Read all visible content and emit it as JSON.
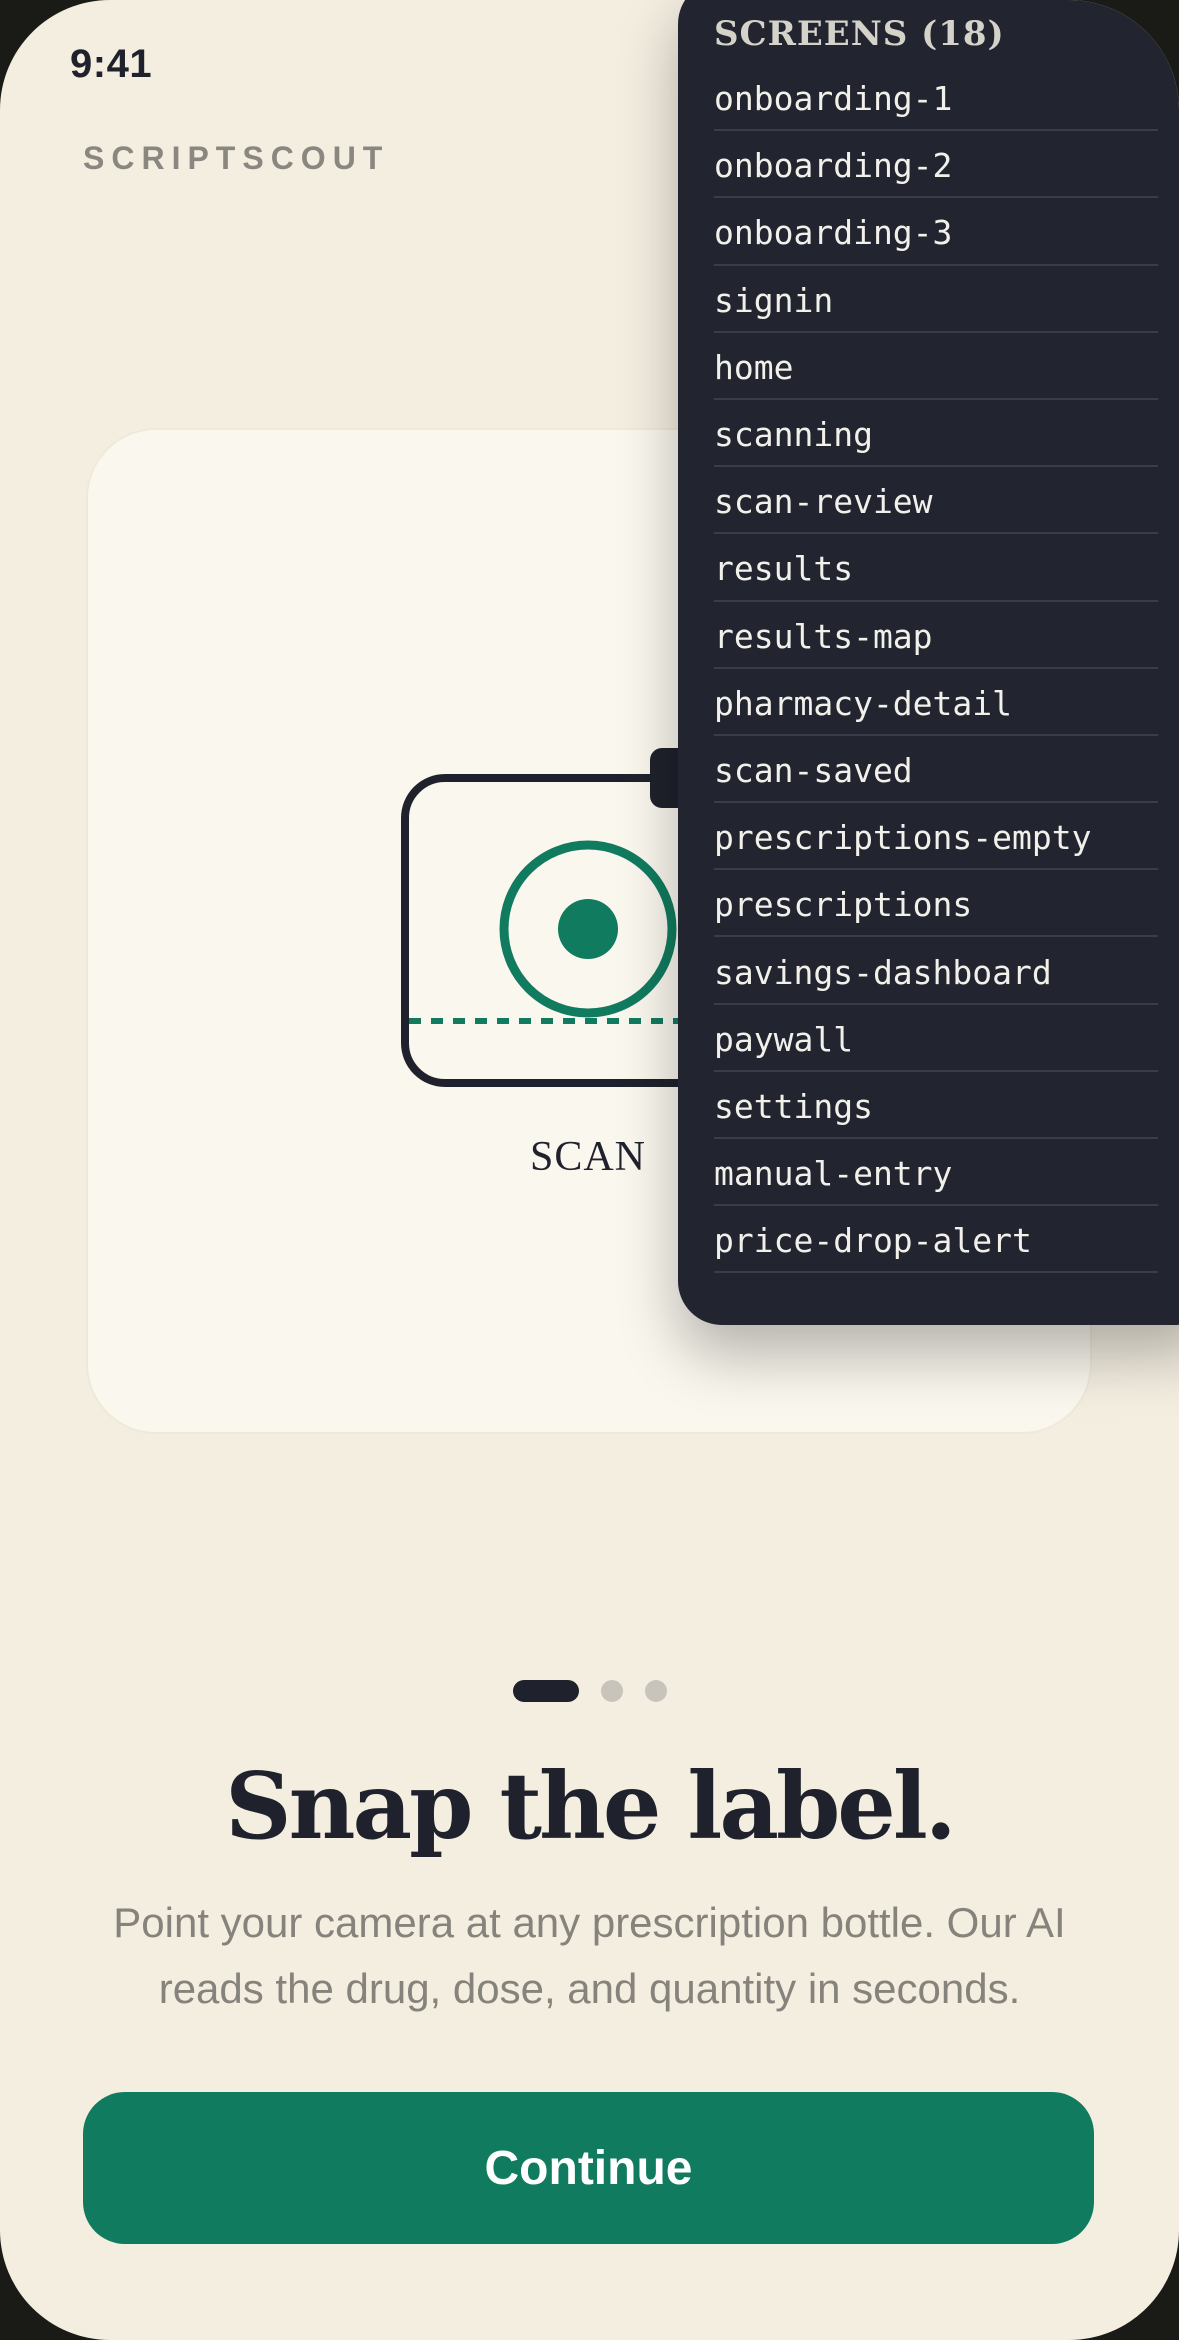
{
  "status_bar": {
    "time": "9:41"
  },
  "brand": "SCRIPTSCOUT",
  "illustration": {
    "label": "SCAN"
  },
  "pager": {
    "count": 3,
    "active": 0
  },
  "headline": "Snap the label.",
  "subtext": "Point your camera at any prescription bottle. Our AI reads the drug, dose, and quantity in seconds.",
  "cta_label": "Continue",
  "screens_panel": {
    "title": "SCREENS (18)",
    "items": [
      "onboarding-1",
      "onboarding-2",
      "onboarding-3",
      "signin",
      "home",
      "scanning",
      "scan-review",
      "results",
      "results-map",
      "pharmacy-detail",
      "scan-saved",
      "prescriptions-empty",
      "prescriptions",
      "savings-dashboard",
      "paywall",
      "settings",
      "manual-entry",
      "price-drop-alert"
    ]
  },
  "colors": {
    "background": "#f4eee1",
    "card": "#faf7ee",
    "ink": "#1f222c",
    "accent": "#117b5f",
    "muted": "#86837c",
    "panel": "#22252f"
  }
}
